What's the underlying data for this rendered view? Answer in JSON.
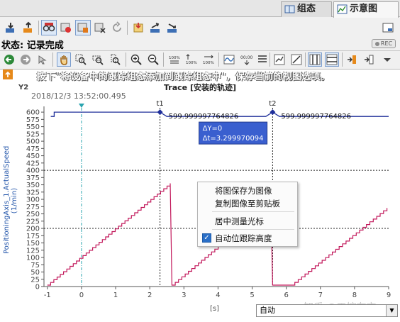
{
  "tabs": [
    {
      "label": "组态",
      "icon": "config-icon"
    },
    {
      "label": "示意图",
      "icon": "diagram-icon"
    }
  ],
  "status": {
    "label": "状态:",
    "value": "记录完成",
    "rec": "REC"
  },
  "hint": "按下\"将设备中的跟踪组态添加到跟踪组态中\"，保存当前的视图选项。",
  "chart": {
    "y2": "Y2",
    "title": "Trace [安装的轨迹]",
    "timestamp": "2018/12/3 13:52:00.495",
    "cursor1": "t1",
    "cursor2": "t2",
    "cursor1_value": "599.999997764826",
    "cursor2_value": "599.999997764826",
    "delta_y": "ΔY=0",
    "delta_t": "Δt=3.299970094",
    "x_unit": "[s]"
  },
  "chart_data": {
    "type": "line",
    "ylabel": "PositioningAxis_1.ActualSpeed (1/min)",
    "x_unit": "[s]",
    "xlim": [
      -1.1,
      9
    ],
    "ylim": [
      0,
      610
    ],
    "x_ticks": [
      "-1",
      "0",
      "1",
      "2",
      "3",
      "4",
      "5",
      "6",
      "7",
      "8",
      "9"
    ],
    "y_ticks": [
      "0",
      "25",
      "50",
      "75",
      "100",
      "125",
      "150",
      "175",
      "200",
      "225",
      "250",
      "275",
      "300",
      "325",
      "350",
      "375",
      "400",
      "425",
      "450",
      "475",
      "500",
      "525",
      "550",
      "575",
      "600"
    ],
    "series": [
      {
        "color": "#1f2f9a",
        "x": [
          -0.9,
          -0.8,
          -0.8,
          2.3,
          2.5,
          2.5,
          5.4,
          5.6,
          5.8,
          5.8,
          9
        ],
        "y": [
          585,
          585,
          600,
          600,
          585,
          585,
          585,
          600,
          585,
          585,
          585
        ],
        "note_x": [
          -0.9,
          9
        ]
      },
      {
        "color": "#c2185b",
        "segments": [
          {
            "x0": -1.0,
            "y0": 5,
            "x1": 2.6,
            "y1": 355,
            "steps": 38
          },
          {
            "x0": 2.6,
            "y0": 355,
            "x1": 2.65,
            "y1": 5,
            "steps": 0
          },
          {
            "x0": 2.65,
            "y0": 5,
            "x1": 5.55,
            "y1": 290,
            "steps": 30
          },
          {
            "x0": 5.55,
            "y0": 290,
            "x1": 5.6,
            "y1": 5,
            "steps": 0
          },
          {
            "x0": 5.6,
            "y0": 5,
            "x1": 6.15,
            "y1": 5,
            "steps": 0
          },
          {
            "x0": 6.15,
            "y0": 5,
            "x1": 8.95,
            "y1": 270,
            "steps": 28
          }
        ]
      }
    ],
    "hlines": [
      400,
      200
    ],
    "cursors_x": [
      2.3,
      5.6
    ],
    "trigger_x": 0,
    "grid": false
  },
  "context_menu": {
    "items": [
      "将图保存为图像",
      "复制图像至剪贴板",
      "居中测量光标",
      "自动位跟踪高度"
    ],
    "checked_item": "自动位跟踪高度"
  },
  "dropdown": {
    "value": "自动"
  },
  "watermark": "知乎 @工控布衣"
}
